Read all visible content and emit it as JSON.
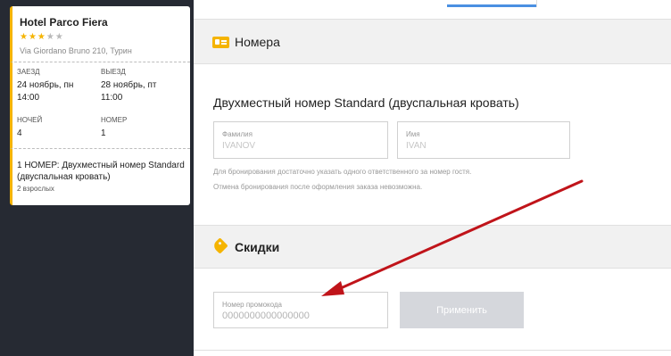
{
  "booking": {
    "hotel_name": "Hotel Parco Fiera",
    "rating": 3,
    "rating_max": 5,
    "stars_on": "★★★",
    "stars_off": "★★",
    "address": "Via Giordano Bruno 210, Турин",
    "checkin_label": "ЗАЕЗД",
    "checkin_date": "24 ноябрь, пн",
    "checkin_time": "14:00",
    "checkout_label": "ВЫЕЗД",
    "checkout_date": "28 ноябрь, пт",
    "checkout_time": "11:00",
    "nights_label": "НОЧЕЙ",
    "nights_value": "4",
    "room_label": "НОМЕР",
    "room_value": "1",
    "room_summary": "1 НОМЕР: Двухместный номер Standard (двуспальная кровать)",
    "guests": "2 взрослых"
  },
  "rooms_section": {
    "title": "Номера",
    "icon": "id-card-icon",
    "room_name": "Двухместный номер Standard (двуспальная кровать)",
    "last_name_label": "Фамилия",
    "last_name_value": "IVANOV",
    "first_name_label": "Имя",
    "first_name_value": "IVAN",
    "note1": "Для бронирования достаточно указать одного ответственного за номер гостя.",
    "note2": "Отмена бронирования после оформления заказа невозможна."
  },
  "discounts_section": {
    "title": "Скидки",
    "icon": "tag-icon",
    "promo_label": "Номер промокода",
    "promo_placeholder": "0000000000000000",
    "apply_label": "Применить"
  },
  "colors": {
    "accent": "#f5b400",
    "sidebar_bg": "#262a33",
    "annotation_arrow": "#c0141a",
    "button_disabled": "#d5d7dc"
  }
}
